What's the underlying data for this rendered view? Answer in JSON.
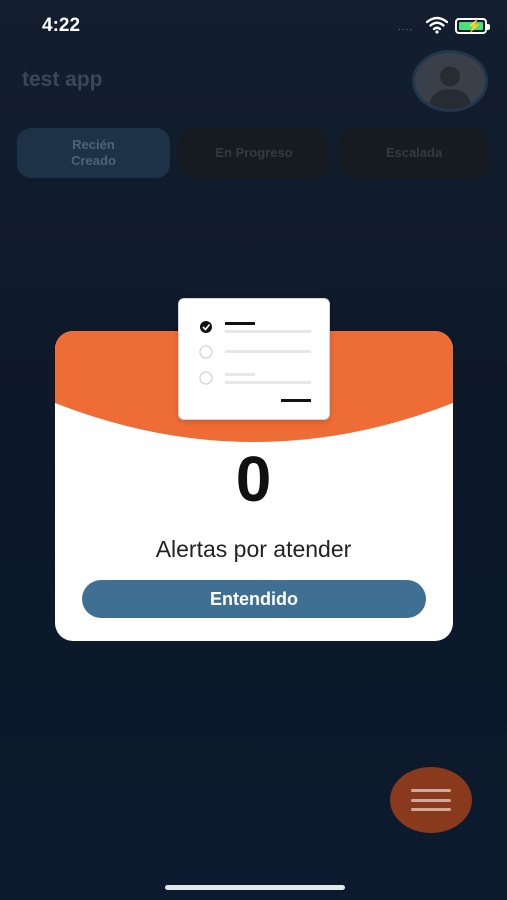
{
  "status_bar": {
    "time": "4:22",
    "signal": "....",
    "battery_color": "#4ade80"
  },
  "header": {
    "title": "test app"
  },
  "tabs": [
    {
      "label_line1": "Recién",
      "label_line2": "Creado",
      "active": true
    },
    {
      "label": "En Progreso",
      "active": false
    },
    {
      "label": "Escalada",
      "active": false
    }
  ],
  "modal": {
    "count": "0",
    "label": "Alertas por atender",
    "button_label": "Entendido",
    "accent_color": "#ee6c35",
    "button_color": "#3f6f92"
  },
  "icons": {
    "avatar": "user-silhouette-icon",
    "fab": "menu-icon",
    "illustration": "checklist-icon"
  }
}
